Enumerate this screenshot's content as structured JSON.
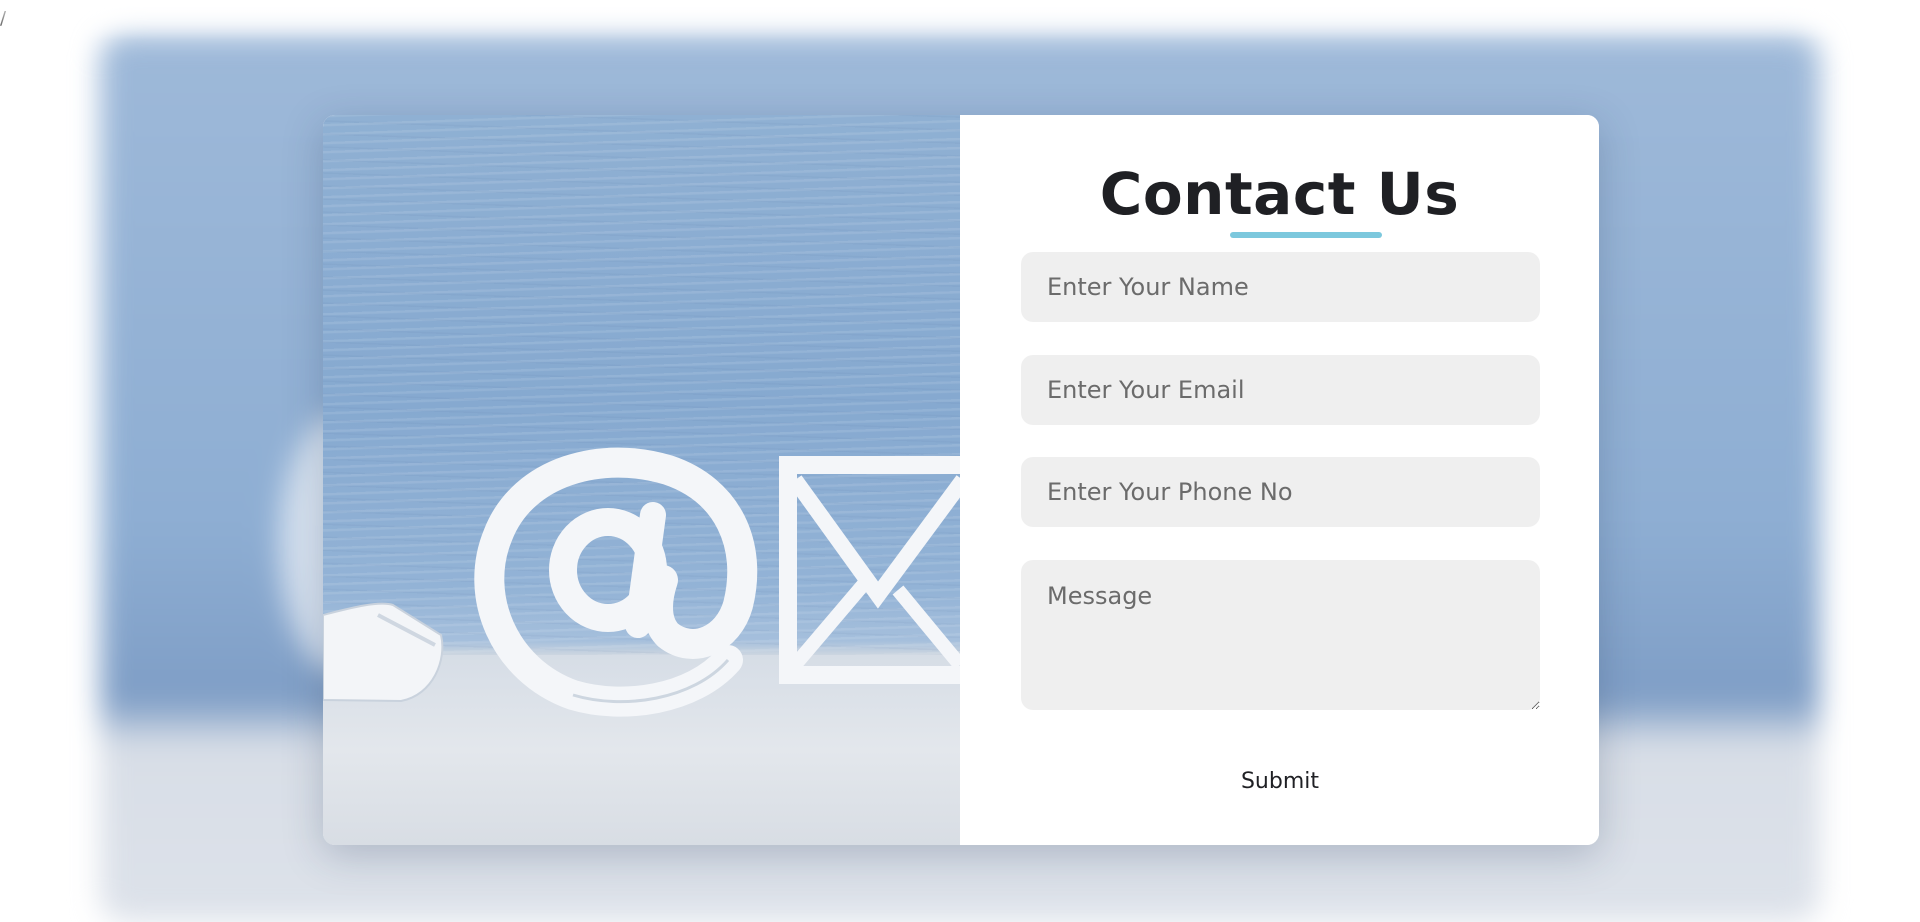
{
  "page": {
    "stray_text": "/"
  },
  "contact": {
    "title": "Contact Us",
    "accent_color": "#7cc8dd",
    "fields": {
      "name_placeholder": "Enter Your Name",
      "email_placeholder": "Enter Your Email",
      "phone_placeholder": "Enter Your Phone No",
      "message_placeholder": "Message"
    },
    "submit_label": "Submit"
  },
  "image": {
    "subject": "contact-icons-photo"
  }
}
